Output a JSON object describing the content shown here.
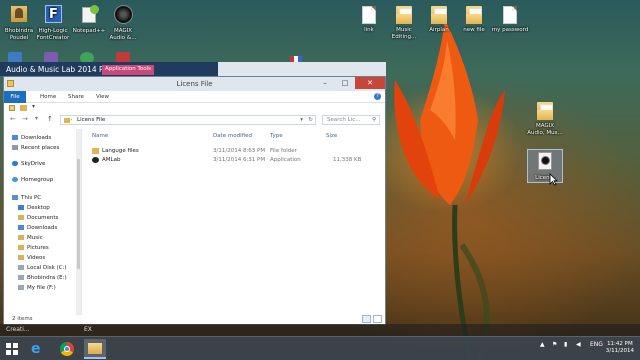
{
  "desktop": {
    "left_icons": [
      {
        "label": "Bhobindra\nPoudel"
      },
      {
        "label": "High-Logic\nFontCreator"
      },
      {
        "label": "Notepad++"
      },
      {
        "label": "MAGIX\nAudio &..."
      }
    ],
    "top_right_icons": [
      {
        "label": "link"
      },
      {
        "label": "Music\nEditing..."
      },
      {
        "label": "Airplan"
      },
      {
        "label": "new file"
      },
      {
        "label": "my password"
      }
    ],
    "side_icons": [
      {
        "label": "MAGIX\nAudio, Mus..."
      },
      {
        "label": "Licen..."
      }
    ]
  },
  "background_window": {
    "title": "Audio & Music Lab 2014 Pre...",
    "badge": "Application Tools"
  },
  "explorer": {
    "title": "Licens File",
    "controls": {
      "minimize": "–",
      "maximize": "□",
      "close": "✕"
    },
    "ribbon_tabs": [
      "File",
      "Home",
      "Share",
      "View"
    ],
    "help": "?",
    "nav": {
      "back": "←",
      "forward": "→",
      "dropdown": "▾",
      "up": "↑"
    },
    "address": "Licens File",
    "address_sep": "›",
    "address_dropdown": "▾",
    "refresh": "↻",
    "search_placeholder": "Search Lic...",
    "search_icon": "⚲",
    "nav_items": [
      {
        "label": "Downloads"
      },
      {
        "label": "Recent places"
      },
      {
        "label": "SkyDrive"
      },
      {
        "label": "Homegroup"
      },
      {
        "label": "This PC"
      },
      {
        "label": "Desktop"
      },
      {
        "label": "Documents"
      },
      {
        "label": "Downloads"
      },
      {
        "label": "Music"
      },
      {
        "label": "Pictures"
      },
      {
        "label": "Videos"
      },
      {
        "label": "Local Disk (C:)"
      },
      {
        "label": "Bhobindra (E:)"
      },
      {
        "label": "My file (F:)"
      }
    ],
    "columns": [
      "Name",
      "Date modified",
      "Type",
      "Size"
    ],
    "files": [
      {
        "name": "Languge files",
        "date": "3/11/2014 8:63 PM",
        "type": "File folder",
        "size": ""
      },
      {
        "name": "AMLab",
        "date": "3/11/2014 6:31 PM",
        "type": "Application",
        "size": "11,338 KB"
      }
    ],
    "status": "2 items"
  },
  "taskbar": {
    "upper_left": "Creati...",
    "upper_mid": "EX",
    "tray_lang": "ENG",
    "time": "11:42 PM",
    "date": "3/11/2014"
  },
  "colors": {
    "file_tab": "#1c6fbd",
    "app_tools": "#c94a7a",
    "close": "#c7463a"
  }
}
